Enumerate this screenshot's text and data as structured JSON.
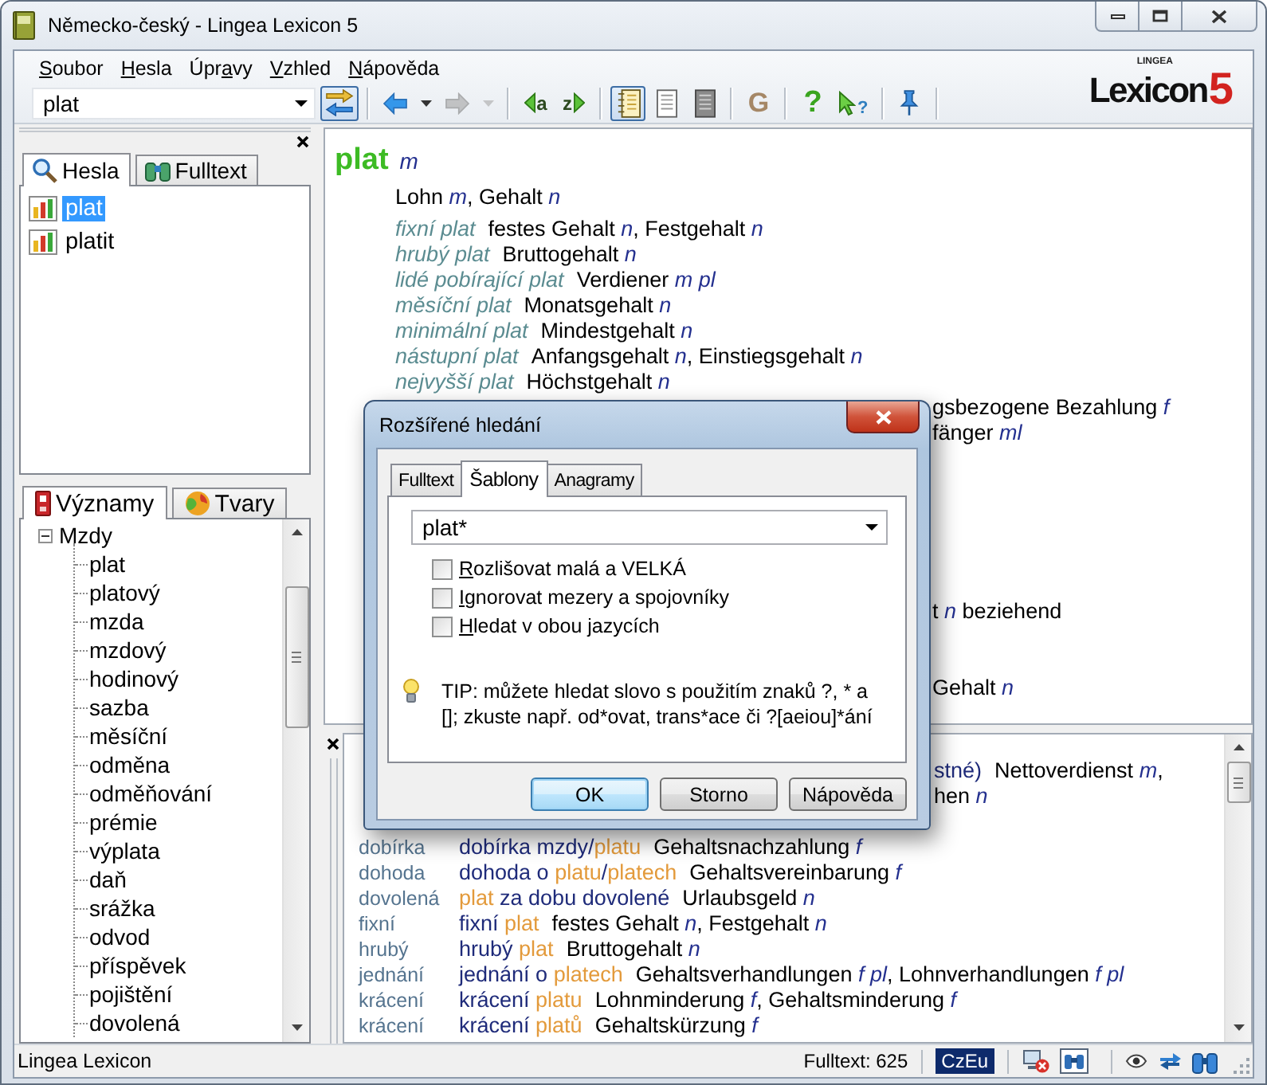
{
  "window": {
    "title": "Německo-český - Lingea Lexicon 5"
  },
  "menu": [
    {
      "key": "S",
      "rest": "oubor"
    },
    {
      "key": "H",
      "rest": "esla"
    },
    {
      "before": "Úpr",
      "key": "a",
      "rest": "vy"
    },
    {
      "key": "V",
      "rest": "zhled"
    },
    {
      "key": "N",
      "rest": "ápověda"
    }
  ],
  "logo": {
    "brand": "LINGEA",
    "name": "Lexicon",
    "version": "5"
  },
  "toolbar": {
    "search": {
      "value": "plat"
    },
    "buttons": [
      {
        "kind": "swap",
        "pressed": true,
        "disabled": false
      },
      {
        "kind": "back",
        "pressed": false,
        "disabled": false
      },
      {
        "kind": "back-menu",
        "pressed": false,
        "disabled": false
      },
      {
        "kind": "forward",
        "pressed": false,
        "disabled": true
      },
      {
        "kind": "forward-menu",
        "pressed": false,
        "disabled": true
      },
      {
        "kind": "prev",
        "label": "a",
        "pressed": false,
        "disabled": false
      },
      {
        "kind": "next",
        "label": "z",
        "pressed": false,
        "disabled": false
      },
      {
        "kind": "view-list",
        "pressed": true,
        "disabled": false
      },
      {
        "kind": "view-page",
        "pressed": false,
        "disabled": false
      },
      {
        "kind": "view-dark",
        "pressed": false,
        "disabled": false
      },
      {
        "kind": "grammar",
        "label": "G",
        "pressed": false,
        "disabled": false
      },
      {
        "kind": "help",
        "label": "?",
        "pressed": false,
        "disabled": false
      },
      {
        "kind": "context-help",
        "label": "?",
        "pressed": false,
        "disabled": false
      },
      {
        "kind": "pin",
        "pressed": false,
        "disabled": false
      }
    ]
  },
  "left_panel": {
    "tabs": [
      {
        "label": "Hesla",
        "selected": true
      },
      {
        "label": "Fulltext",
        "selected": false
      }
    ],
    "entries": [
      {
        "label": "plat",
        "selected": true
      },
      {
        "label": "platit",
        "selected": false
      }
    ],
    "lower_tabs": [
      {
        "label": "Významy",
        "selected": true
      },
      {
        "label": "Tvary",
        "selected": false
      }
    ],
    "tree": [
      {
        "label": "Mzdy",
        "expanded": true,
        "children": [
          {
            "label": "plat"
          },
          {
            "label": "platový"
          },
          {
            "label": "mzda"
          },
          {
            "label": "mzdový"
          },
          {
            "label": "hodinový"
          },
          {
            "label": "sazba"
          },
          {
            "label": "měsíční"
          },
          {
            "label": "odměna"
          },
          {
            "label": "odměňování"
          },
          {
            "label": "prémie"
          },
          {
            "label": "výplata"
          },
          {
            "label": "daň"
          },
          {
            "label": "srážka"
          },
          {
            "label": "odvod"
          },
          {
            "label": "příspěvek"
          },
          {
            "label": "pojištění"
          },
          {
            "label": "dovolená"
          }
        ]
      }
    ]
  },
  "entry": {
    "headword": "plat",
    "gender": "m",
    "translation": "Lohn *m*, Gehalt *n*",
    "phrases": [
      {
        "phrase": "fixní plat",
        "translation": "festes Gehalt *n*, Festgehalt *n*"
      },
      {
        "phrase": "hrubý plat",
        "translation": "Bruttogehalt *n*"
      },
      {
        "phrase": "lidé pobírající plat",
        "translation": "Verdiener *m pl*"
      },
      {
        "phrase": "měsíční plat",
        "translation": "Monatsgehalt *n*"
      },
      {
        "phrase": "minimální plat",
        "translation": "Mindestgehalt *n*"
      },
      {
        "phrase": "nástupní plat",
        "translation": "Anfangsgehalt *n*, Einstiegsgehalt *n*"
      },
      {
        "phrase": "nejvyšší plat",
        "translation": "Höchstgehalt *n*"
      }
    ],
    "partly_hidden_lines": [
      "gsbezogene Bezahlung *f*",
      "fänger *ml*",
      "t *n* beziehend",
      "Gehalt *n*"
    ]
  },
  "results": {
    "partly_hidden_rows": [
      {
        "phrase": "stné)",
        "translation": "Nettoverdienst *m*,"
      },
      {
        "translation": "hen *n*"
      }
    ],
    "rows": [
      {
        "key": "dobírka",
        "phrase": [
          {
            "text": "dobírka mzdy/",
            "match": false
          },
          {
            "text": "platu",
            "match": true
          }
        ],
        "translation": "Gehaltsnachzahlung *f*"
      },
      {
        "key": "dohoda",
        "phrase": [
          {
            "text": "dohoda o ",
            "match": false
          },
          {
            "text": "platu",
            "match": true
          },
          {
            "text": "/",
            "match": false
          },
          {
            "text": "platech",
            "match": true
          }
        ],
        "translation": "Gehaltsvereinbarung *f*"
      },
      {
        "key": "dovolená",
        "phrase": [
          {
            "text": "plat",
            "match": true
          },
          {
            "text": " za dobu dovolené",
            "match": false
          }
        ],
        "translation": "Urlaubsgeld *n*"
      },
      {
        "key": "fixní",
        "phrase": [
          {
            "text": "fixní ",
            "match": false
          },
          {
            "text": "plat",
            "match": true
          }
        ],
        "translation": "festes Gehalt *n*, Festgehalt *n*"
      },
      {
        "key": "hrubý",
        "phrase": [
          {
            "text": "hrubý ",
            "match": false
          },
          {
            "text": "plat",
            "match": true
          }
        ],
        "translation": "Bruttogehalt *n*"
      },
      {
        "key": "jednání",
        "phrase": [
          {
            "text": "jednání o ",
            "match": false
          },
          {
            "text": "platech",
            "match": true
          }
        ],
        "translation": "Gehaltsverhandlungen *f pl*, Lohnverhandlungen *f pl*"
      },
      {
        "key": "krácení",
        "phrase": [
          {
            "text": "krácení ",
            "match": false
          },
          {
            "text": "platu",
            "match": true
          }
        ],
        "translation": "Lohnminderung *f*, Gehaltsminderung *f*"
      },
      {
        "key": "krácení",
        "phrase": [
          {
            "text": "krácení ",
            "match": false
          },
          {
            "text": "platů",
            "match": true
          }
        ],
        "translation": "Gehaltskürzung *f*"
      }
    ]
  },
  "status_bar": {
    "text": "Lingea Lexicon",
    "count": "Fulltext: 625",
    "language": "CzEu"
  },
  "dialog": {
    "title": "Rozšířené hledání",
    "tabs": [
      {
        "label": "Fulltext",
        "selected": false
      },
      {
        "label": "Šablony",
        "selected": true
      },
      {
        "label": "Anagramy",
        "selected": false
      }
    ],
    "pattern": {
      "value": "plat*"
    },
    "options": [
      {
        "key": "R",
        "rest": "ozlišovat malá a VELKÁ",
        "checked": false
      },
      {
        "key": "I",
        "rest": "gnorovat mezery a spojovníky",
        "checked": false
      },
      {
        "key": "H",
        "rest": "ledat v obou jazycích",
        "checked": false
      }
    ],
    "tip": "TIP: můžete hledat slovo s použitím znaků ?, * a []; zkuste např. od*ovat, trans*ace či ?[aeiou]*ání",
    "buttons": [
      {
        "label": "OK",
        "default": true
      },
      {
        "label": "Storno",
        "default": false
      },
      {
        "label": "Nápověda",
        "default": false
      }
    ]
  }
}
